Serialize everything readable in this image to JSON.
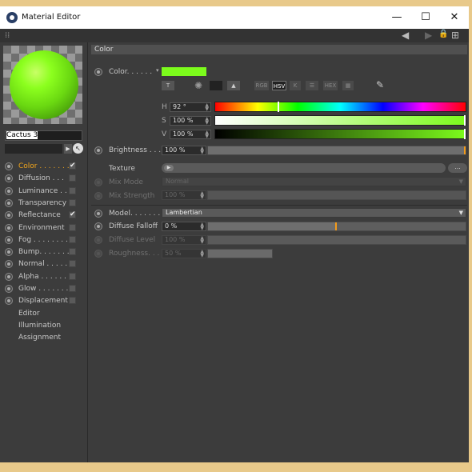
{
  "window": {
    "title": "Material Editor",
    "minimize": "—",
    "maximize": "☐",
    "close": "✕"
  },
  "toolbar": {
    "grip": "⁞⁞",
    "back_icon": "◀",
    "forward_icon": "▶",
    "lock_icon": "🔒",
    "new_icon": "⊞"
  },
  "material": {
    "name": "Cactus 3"
  },
  "channels": [
    {
      "label": "Color . . . . . . .",
      "enabled": "✔",
      "active": true
    },
    {
      "label": "Diffusion . . .",
      "enabled": "",
      "active": false
    },
    {
      "label": "Luminance . .",
      "enabled": "",
      "active": false
    },
    {
      "label": "Transparency",
      "enabled": "",
      "active": false
    },
    {
      "label": "Reflectance",
      "enabled": "✔",
      "active": false
    },
    {
      "label": "Environment",
      "enabled": "",
      "active": false
    },
    {
      "label": "Fog . . . . . . . .",
      "enabled": "",
      "active": false
    },
    {
      "label": "Bump. . . . . . .",
      "enabled": "",
      "active": false
    },
    {
      "label": "Normal . . . . .",
      "enabled": "",
      "active": false
    },
    {
      "label": "Alpha . . . . . .",
      "enabled": "",
      "active": false
    },
    {
      "label": "Glow . . . . . . .",
      "enabled": "",
      "active": false
    },
    {
      "label": "Displacement",
      "enabled": "",
      "active": false
    }
  ],
  "extra_items": [
    "Editor",
    "Illumination",
    "Assignment"
  ],
  "section": {
    "title": "Color"
  },
  "color": {
    "label": "Color. . . . . .",
    "swatch": "#7cfb1c",
    "modes": [
      "RGB",
      "HSV",
      "K",
      "☰",
      "HEX",
      "▦"
    ],
    "active_mode": "HSV",
    "h_label": "H",
    "h_value": "92 °",
    "h_level": 0.256,
    "s_label": "S",
    "s_value": "100 %",
    "s_level": 1.0,
    "v_label": "V",
    "v_value": "100 %",
    "v_level": 1.0
  },
  "brightness": {
    "label": "Brightness . . .",
    "value": "100 %",
    "level": 1.0
  },
  "texture": {
    "label": "Texture",
    "dots": "..."
  },
  "mix_mode": {
    "label": "Mix Mode",
    "value": "Normal"
  },
  "mix_strength": {
    "label": "Mix Strength",
    "value": "100 %"
  },
  "model": {
    "label": "Model. . . . . . .",
    "value": "Lambertian"
  },
  "diffuse_falloff": {
    "label": "Diffuse Falloff",
    "value": "0 %",
    "level": 0.5
  },
  "diffuse_level": {
    "label": "Diffuse Level",
    "value": "100 %"
  },
  "roughness": {
    "label": "Roughness. . .",
    "value": "50 %",
    "level": 0.25
  },
  "colors": {
    "accent": "#f29b1b",
    "panel": "#3c3c3c"
  }
}
